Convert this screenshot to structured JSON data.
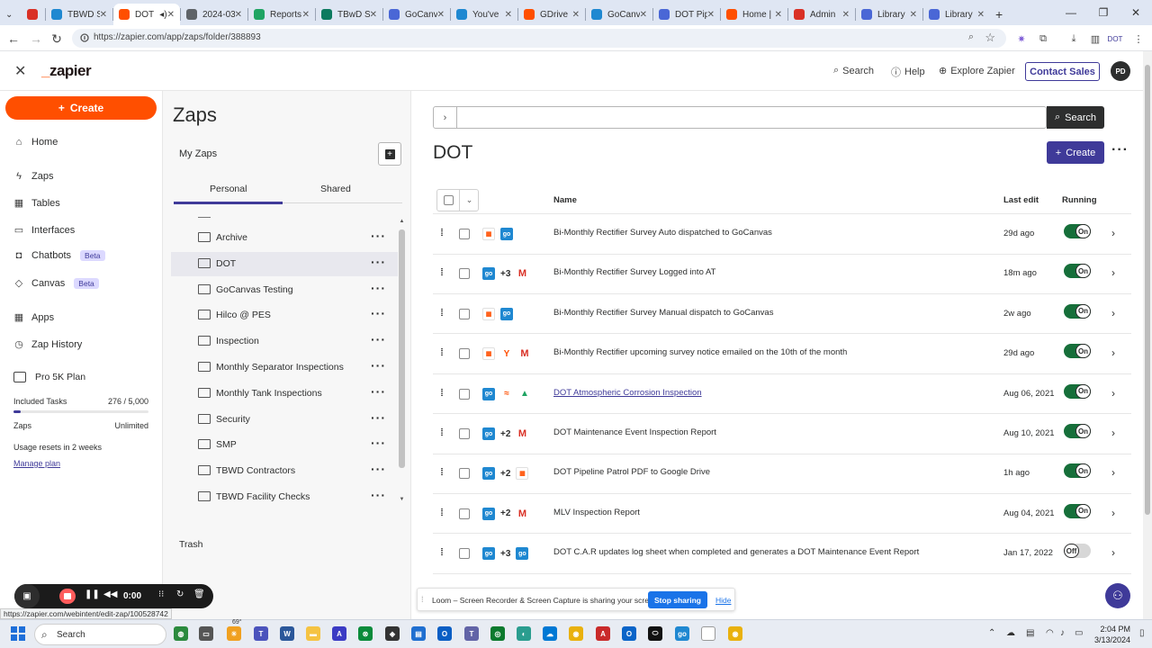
{
  "browser": {
    "tabs": [
      {
        "label": "",
        "icon": "opera-icon",
        "color": "#d93025",
        "active": false
      },
      {
        "label": "TBWD S",
        "icon": "gocanvas-icon",
        "color": "#1f88d1",
        "active": false
      },
      {
        "label": "DOT",
        "icon": "zapier-icon",
        "color": "#ff4f00",
        "active": true
      },
      {
        "label": "2024-03",
        "icon": "web-icon",
        "color": "#5f6368",
        "active": false
      },
      {
        "label": "Reports",
        "icon": "drive-icon",
        "color": "#1fa463",
        "active": false
      },
      {
        "label": "TBwD S",
        "icon": "tb-icon",
        "color": "#0d7a5f",
        "active": false
      },
      {
        "label": "GoCanv",
        "icon": "gear-icon",
        "color": "#4a67d6",
        "active": false
      },
      {
        "label": "You've",
        "icon": "go-icon",
        "color": "#1f88d1",
        "active": false
      },
      {
        "label": "GDrive",
        "icon": "zapier-icon",
        "color": "#ff4f00",
        "active": false
      },
      {
        "label": "GoCanv",
        "icon": "go-icon",
        "color": "#1f88d1",
        "active": false
      },
      {
        "label": "DOT Pip",
        "icon": "gear-icon",
        "color": "#4a67d6",
        "active": false
      },
      {
        "label": "Home |",
        "icon": "zapier-icon",
        "color": "#ff4f00",
        "active": false
      },
      {
        "label": "Admin",
        "icon": "target-icon",
        "color": "#d93025",
        "active": false
      },
      {
        "label": "Library",
        "icon": "gear-icon",
        "color": "#4a67d6",
        "active": false
      },
      {
        "label": "Library",
        "icon": "gear-icon",
        "color": "#4a67d6",
        "active": false
      }
    ],
    "new_tab": "+",
    "url": "https://zapier.com/app/zaps/folder/388893",
    "profile_label": "DOT"
  },
  "header": {
    "logo": "zapier",
    "search_label": "Search",
    "help_label": "Help",
    "explore_label": "Explore Zapier",
    "contact_label": "Contact Sales",
    "avatar_initials": "PD"
  },
  "leftnav": {
    "create_label": "Create",
    "items": [
      {
        "label": "Home",
        "icon": "home-icon"
      },
      {
        "label": "Zaps",
        "icon": "bolt-icon"
      },
      {
        "label": "Tables",
        "icon": "table-icon"
      },
      {
        "label": "Interfaces",
        "icon": "interfaces-icon"
      },
      {
        "label": "Chatbots",
        "icon": "chatbot-icon",
        "badge": "Beta"
      },
      {
        "label": "Canvas",
        "icon": "canvas-icon",
        "badge": "Beta"
      },
      {
        "label": "Apps",
        "icon": "apps-icon"
      },
      {
        "label": "Zap History",
        "icon": "history-icon"
      }
    ],
    "plan_name": "Pro 5K Plan",
    "included_tasks_label": "Included Tasks",
    "included_tasks_value": "276 / 5,000",
    "tasks_fraction": 0.0552,
    "zaps_label": "Zaps",
    "zaps_value": "Unlimited",
    "resets_text": "Usage resets in 2 weeks",
    "manage_label": "Manage plan"
  },
  "folders": {
    "title": "Zaps",
    "my_zaps": "My Zaps",
    "tabs": [
      "Personal",
      "Shared"
    ],
    "items": [
      {
        "name": "Archive",
        "selected": false
      },
      {
        "name": "DOT",
        "selected": true
      },
      {
        "name": "GoCanvas Testing",
        "selected": false
      },
      {
        "name": "Hilco @ PES",
        "selected": false
      },
      {
        "name": "Inspection",
        "selected": false
      },
      {
        "name": "Monthly Separator Inspections",
        "selected": false
      },
      {
        "name": "Monthly Tank Inspections",
        "selected": false
      },
      {
        "name": "Security",
        "selected": false
      },
      {
        "name": "SMP",
        "selected": false
      },
      {
        "name": "TBWD Contractors",
        "selected": false
      },
      {
        "name": "TBWD Facility Checks",
        "selected": false
      }
    ],
    "trash_label": "Trash"
  },
  "main": {
    "search_label": "Search",
    "title": "DOT",
    "create_label": "Create",
    "columns": {
      "name": "Name",
      "last_edit": "Last edit",
      "running": "Running"
    },
    "zaps": [
      {
        "apps": [
          "sched",
          "go"
        ],
        "extra": "",
        "name": "Bi-Monthly Rectifier Survey Auto dispatched to GoCanvas",
        "last_edit": "29d ago",
        "status": "On",
        "link": false
      },
      {
        "apps": [
          "go",
          "gmail"
        ],
        "extra": "+3",
        "name": "Bi-Monthly Rectifier Survey Logged into AT",
        "last_edit": "18m ago",
        "status": "On",
        "link": false
      },
      {
        "apps": [
          "sched",
          "go"
        ],
        "extra": "",
        "name": "Bi-Monthly Rectifier Survey Manual dispatch to GoCanvas",
        "last_edit": "2w ago",
        "status": "On",
        "link": false
      },
      {
        "apps": [
          "sched",
          "filter",
          "gmail"
        ],
        "extra": "",
        "name": "Bi-Monthly Rectifier upcoming survey notice emailed on the 10th of the month",
        "last_edit": "29d ago",
        "status": "On",
        "link": false
      },
      {
        "apps": [
          "go",
          "fmt",
          "drive"
        ],
        "extra": "",
        "name": "DOT Atmospheric Corrosion Inspection",
        "last_edit": "Aug 06, 2021",
        "status": "On",
        "link": true
      },
      {
        "apps": [
          "go",
          "gmail"
        ],
        "extra": "+2",
        "name": "DOT Maintenance Event Inspection Report",
        "last_edit": "Aug 10, 2021",
        "status": "On",
        "link": false
      },
      {
        "apps": [
          "go",
          "sched"
        ],
        "extra": "+2",
        "name": "DOT Pipeline Patrol PDF to Google Drive",
        "last_edit": "1h ago",
        "status": "On",
        "link": false
      },
      {
        "apps": [
          "go",
          "gmail"
        ],
        "extra": "+2",
        "name": "MLV Inspection Report",
        "last_edit": "Aug 04, 2021",
        "status": "On",
        "link": false
      },
      {
        "apps": [
          "go",
          "go"
        ],
        "extra": "+3",
        "name": "DOT C.A.R updates log sheet when completed and generates a DOT Maintenance Event Report",
        "last_edit": "Jan 17, 2022",
        "status": "Off",
        "link": false
      }
    ]
  },
  "loom": {
    "timer": "0:00",
    "share_text": "Loom – Screen Recorder & Screen Capture is sharing your screen.",
    "stop_label": "Stop sharing",
    "hide_label": "Hide"
  },
  "status_url": "https://zapier.com/webintent/edit-zap/100528742",
  "taskbar": {
    "search_label": "Search",
    "time": "2:04 PM",
    "date": "3/13/2024",
    "weather": "69°"
  },
  "colors": {
    "brand_orange": "#ff4f00",
    "brand_purple": "#3f3a99",
    "toggle_on": "#166f3a"
  }
}
